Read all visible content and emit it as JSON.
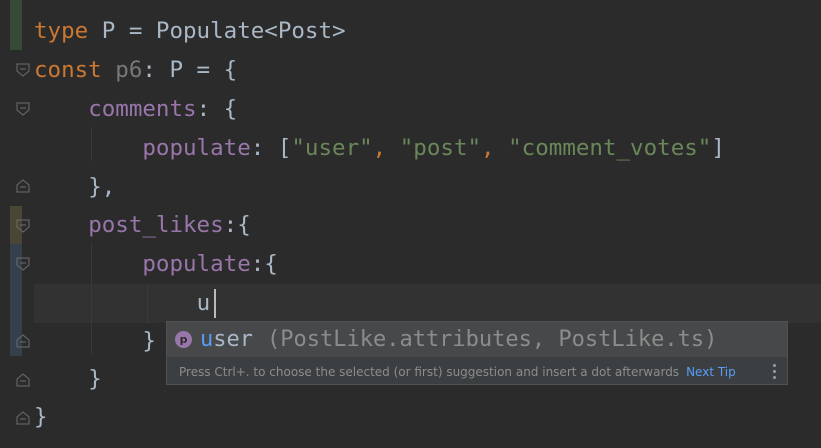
{
  "colors": {
    "background": "#2b2b2b",
    "keyword": "#cc7832",
    "property": "#9876aa",
    "string": "#6a8759",
    "default_text": "#a9b7c6",
    "muted": "#787878",
    "link": "#589df6"
  },
  "code": {
    "line1": {
      "kw": "type",
      "rest": " P = Populate<Post>"
    },
    "line2": {
      "kw": "const",
      "var": " p6",
      "rest": ": P = {"
    },
    "line3": {
      "indent": "    ",
      "prop": "comments",
      "rest": ": {"
    },
    "line4": {
      "indent": "        ",
      "prop": "populate",
      "rest1": ": [",
      "s1": "\"user\"",
      "c1": ", ",
      "s2": "\"post\"",
      "c2": ", ",
      "s3": "\"comment_votes\"",
      "rest2": "]"
    },
    "line5": {
      "indent": "    ",
      "text": "},"
    },
    "line6": {
      "indent": "    ",
      "prop": "post_likes",
      "rest": ":{"
    },
    "line7": {
      "indent": "        ",
      "prop": "populate",
      "rest": ":{"
    },
    "line8": {
      "indent": "            ",
      "text": "u"
    },
    "line9": {
      "indent": "        ",
      "text": "}"
    },
    "line10": {
      "indent": "    ",
      "text": "}"
    },
    "line11": {
      "text": "}"
    }
  },
  "completion": {
    "icon_letter": "p",
    "match": "u",
    "rest": "ser",
    "location": "(PostLike.attributes, PostLike.ts)",
    "hint": "Press Ctrl+. to choose the selected (or first) suggestion and insert a dot afterwards",
    "next_tip": "Next Tip"
  }
}
